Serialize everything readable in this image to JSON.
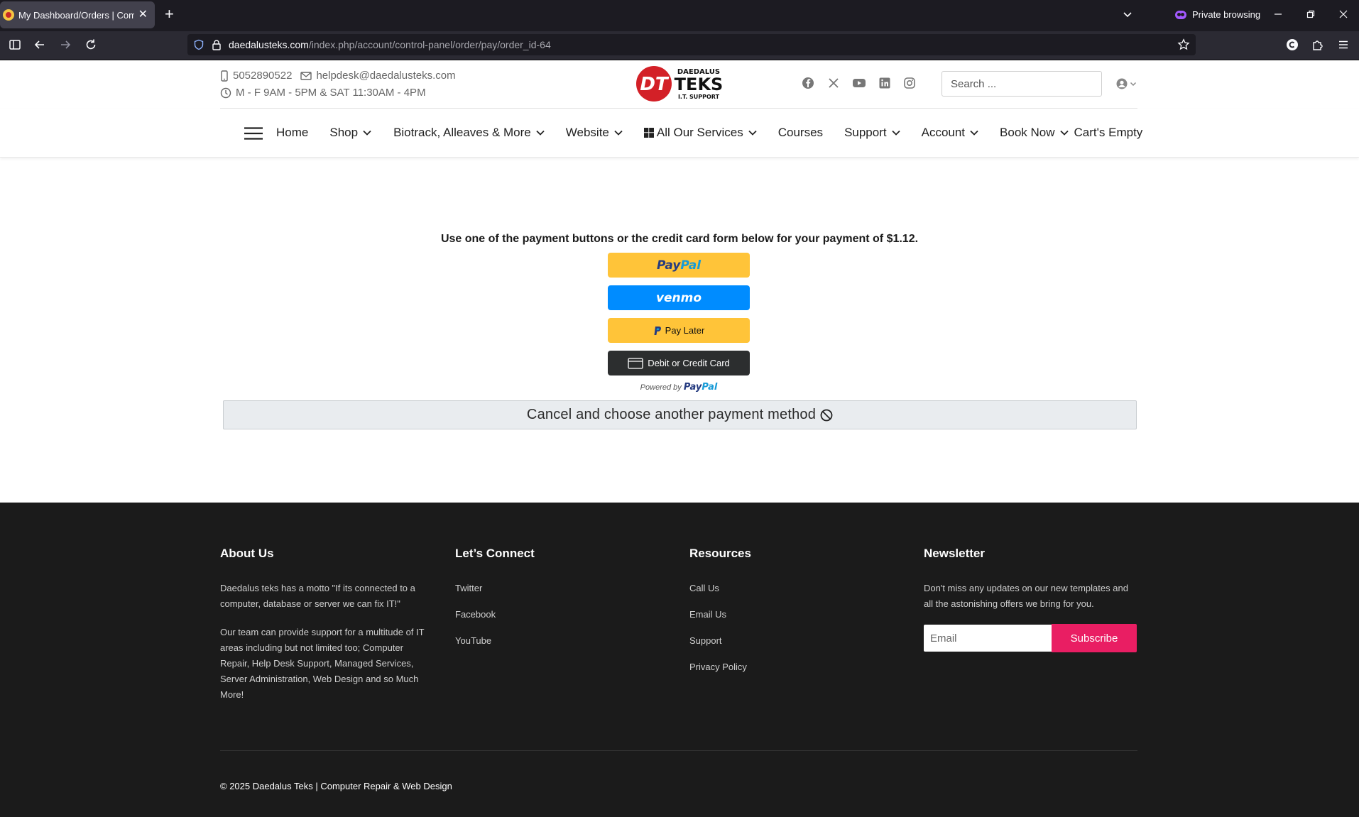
{
  "browser": {
    "tab_title": "My Dashboard/Orders | Compu",
    "url_host": "daedalusteks.com",
    "url_path": "/index.php/account/control-panel/order/pay/order_id-64",
    "private_label": "Private browsing"
  },
  "header": {
    "phone": "5052890522",
    "email": "helpdesk@daedalusteks.com",
    "hours": "M - F 9AM - 5PM & SAT 11:30AM - 4PM",
    "logo": {
      "mark": "DT",
      "top": "DAEDALUS",
      "main": "TEKS",
      "sub": "I.T. SUPPORT"
    },
    "search_placeholder": "Search ..."
  },
  "nav": {
    "items": [
      {
        "label": "Home"
      },
      {
        "label": "Shop"
      },
      {
        "label": "Biotrack, Alleaves & More"
      },
      {
        "label": "Website"
      },
      {
        "label": "All Our Services"
      },
      {
        "label": "Courses"
      },
      {
        "label": "Support"
      },
      {
        "label": "Account"
      },
      {
        "label": "Book Now"
      },
      {
        "label": "Cart's Empty"
      }
    ]
  },
  "payment": {
    "instruction": "Use one of the payment buttons or the credit card form below for your payment of $1.12.",
    "paypal_a": "Pay",
    "paypal_b": "Pal",
    "venmo": "venmo",
    "pay_later": "Pay Later",
    "card": "Debit or Credit Card",
    "powered_by": "Powered by",
    "cancel": "Cancel and choose another payment method"
  },
  "footer": {
    "about": {
      "title": "About Us",
      "p1": "Daedalus teks has a motto \"If its connected to a computer, database or server we can fix IT!\"",
      "p2": "Our team can provide support for a multitude of IT areas including but not limited too; Computer Repair, Help Desk Support, Managed Services, Server Administration, Web Design and so Much More!"
    },
    "connect": {
      "title": "Let’s Connect",
      "links": [
        "Twitter",
        "Facebook",
        "YouTube"
      ]
    },
    "resources": {
      "title": "Resources",
      "links": [
        "Call Us",
        "Email Us",
        "Support",
        "Privacy Policy"
      ]
    },
    "newsletter": {
      "title": "Newsletter",
      "text": "Don't miss any updates on our new templates and all the astonishing offers we bring for you.",
      "email_placeholder": "Email",
      "button": "Subscribe"
    },
    "copyright": "© 2025 Daedalus Teks | Computer Repair & Web Design"
  },
  "colors": {
    "paypal_yellow": "#ffc439",
    "venmo_blue": "#008cff",
    "subscribe_pink": "#e91e63",
    "footer_bg": "#1b1b1b"
  }
}
